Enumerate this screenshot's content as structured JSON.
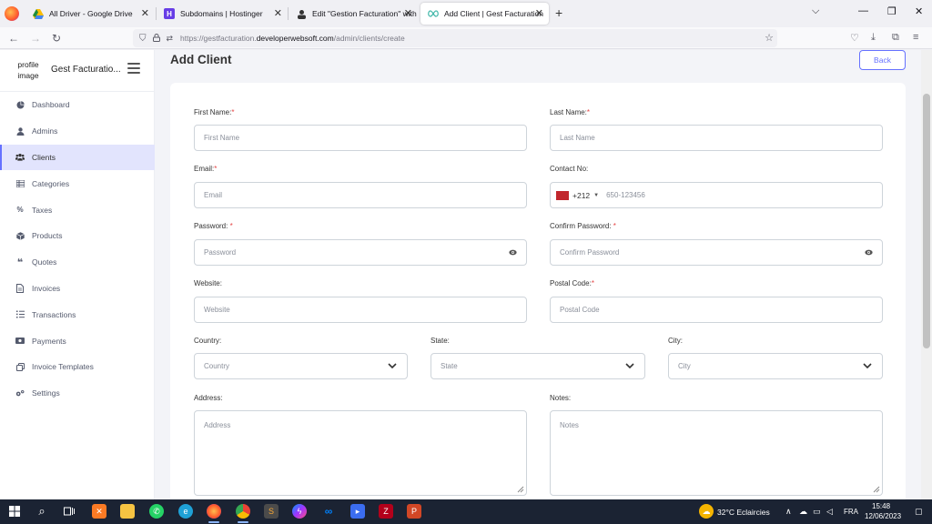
{
  "browser": {
    "tabs": [
      {
        "title": "All Driver - Google Drive",
        "active": false
      },
      {
        "title": "Subdomains | Hostinger",
        "active": false
      },
      {
        "title": "Edit \"Gestion Facturation\" with",
        "active": false
      },
      {
        "title": "Add Client | Gest Facturation",
        "active": true
      }
    ],
    "url_prefix": "https://gestfacturation.",
    "url_domain": "developerwebsoft.com",
    "url_path": "/admin/clients/create"
  },
  "sidebar": {
    "profile_image_alt": "profile image",
    "brand": "Gest Facturatio...",
    "items": [
      {
        "label": "Dashboard",
        "icon": "dashboard-icon"
      },
      {
        "label": "Admins",
        "icon": "user-icon"
      },
      {
        "label": "Clients",
        "icon": "users-icon",
        "active": true
      },
      {
        "label": "Categories",
        "icon": "list-icon"
      },
      {
        "label": "Taxes",
        "icon": "percent-icon"
      },
      {
        "label": "Products",
        "icon": "box-icon"
      },
      {
        "label": "Quotes",
        "icon": "quote-icon"
      },
      {
        "label": "Invoices",
        "icon": "file-icon"
      },
      {
        "label": "Transactions",
        "icon": "transactions-icon"
      },
      {
        "label": "Payments",
        "icon": "money-icon"
      },
      {
        "label": "Invoice Templates",
        "icon": "copy-icon"
      },
      {
        "label": "Settings",
        "icon": "gears-icon"
      }
    ]
  },
  "main": {
    "title": "Add Client",
    "back_label": "Back",
    "form": {
      "first_name": {
        "label": "First Name:",
        "required": "*",
        "placeholder": "First Name"
      },
      "last_name": {
        "label": "Last Name:",
        "required": "*",
        "placeholder": "Last Name"
      },
      "email": {
        "label": "Email:",
        "required": "*",
        "placeholder": "Email"
      },
      "contact": {
        "label": "Contact No:",
        "dial_code": "+212",
        "placeholder": "650-123456"
      },
      "password": {
        "label": "Password: ",
        "required": "*",
        "placeholder": "Password"
      },
      "confirm_password": {
        "label": "Confirm Password: ",
        "required": "*",
        "placeholder": "Confirm Password"
      },
      "website": {
        "label": "Website:",
        "placeholder": "Website"
      },
      "postal_code": {
        "label": "Postal Code:",
        "required": "*",
        "placeholder": "Postal Code"
      },
      "country": {
        "label": "Country:",
        "placeholder": "Country"
      },
      "state": {
        "label": "State:",
        "placeholder": "State"
      },
      "city": {
        "label": "City:",
        "placeholder": "City"
      },
      "address": {
        "label": "Address:",
        "placeholder": "Address"
      },
      "notes": {
        "label": "Notes:",
        "placeholder": "Notes"
      }
    }
  },
  "taskbar": {
    "weather": "32°C  Eclaircies",
    "lang": "FRA",
    "time": "15:48",
    "date": "12/06/2023"
  },
  "colors": {
    "accent": "#6571ff",
    "required": "#e54444",
    "active_bg": "#e2e4fd"
  }
}
